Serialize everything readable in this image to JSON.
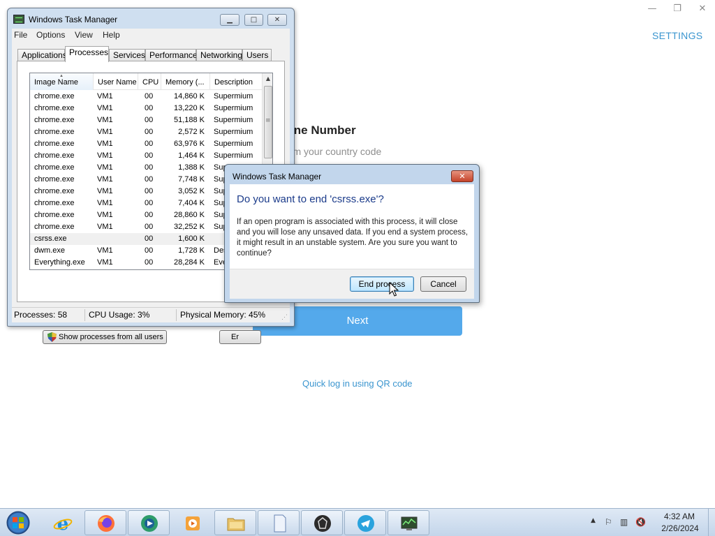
{
  "telegram": {
    "settings_label": "SETTINGS",
    "title_partial": "hone Number",
    "subtitle_partial": "nfirm your country code",
    "next_label": "Next",
    "qr_link": "Quick log in using QR code",
    "minimize_glyph": "—",
    "restore_glyph": "❐",
    "close_glyph": "✕"
  },
  "task_manager": {
    "title": "Windows Task Manager",
    "menu": [
      "File",
      "Options",
      "View",
      "Help"
    ],
    "tabs": [
      "Applications",
      "Processes",
      "Services",
      "Performance",
      "Networking",
      "Users"
    ],
    "active_tab": "Processes",
    "columns": [
      "Image Name",
      "User Name",
      "CPU",
      "Memory (...",
      "Description"
    ],
    "rows": [
      {
        "name": "chrome.exe",
        "user": "VM1",
        "cpu": "00",
        "mem": "14,860 K",
        "desc": "Supermium"
      },
      {
        "name": "chrome.exe",
        "user": "VM1",
        "cpu": "00",
        "mem": "13,220 K",
        "desc": "Supermium"
      },
      {
        "name": "chrome.exe",
        "user": "VM1",
        "cpu": "00",
        "mem": "51,188 K",
        "desc": "Supermium"
      },
      {
        "name": "chrome.exe",
        "user": "VM1",
        "cpu": "00",
        "mem": "2,572 K",
        "desc": "Supermium"
      },
      {
        "name": "chrome.exe",
        "user": "VM1",
        "cpu": "00",
        "mem": "63,976 K",
        "desc": "Supermium"
      },
      {
        "name": "chrome.exe",
        "user": "VM1",
        "cpu": "00",
        "mem": "1,464 K",
        "desc": "Supermium"
      },
      {
        "name": "chrome.exe",
        "user": "VM1",
        "cpu": "00",
        "mem": "1,388 K",
        "desc": "Sup"
      },
      {
        "name": "chrome.exe",
        "user": "VM1",
        "cpu": "00",
        "mem": "7,748 K",
        "desc": "Sup"
      },
      {
        "name": "chrome.exe",
        "user": "VM1",
        "cpu": "00",
        "mem": "3,052 K",
        "desc": "Sup"
      },
      {
        "name": "chrome.exe",
        "user": "VM1",
        "cpu": "00",
        "mem": "7,404 K",
        "desc": "Sup"
      },
      {
        "name": "chrome.exe",
        "user": "VM1",
        "cpu": "00",
        "mem": "28,860 K",
        "desc": "Sup"
      },
      {
        "name": "chrome.exe",
        "user": "VM1",
        "cpu": "00",
        "mem": "32,252 K",
        "desc": "Sup"
      },
      {
        "name": "csrss.exe",
        "user": "",
        "cpu": "00",
        "mem": "1,600 K",
        "desc": "",
        "selected": true
      },
      {
        "name": "dwm.exe",
        "user": "VM1",
        "cpu": "00",
        "mem": "1,728 K",
        "desc": "Des"
      },
      {
        "name": "Everything.exe",
        "user": "VM1",
        "cpu": "00",
        "mem": "28,284 K",
        "desc": "Eve"
      }
    ],
    "show_all_label": "Show processes from all users",
    "end_process_partial": "Er",
    "status": {
      "processes": "Processes: 58",
      "cpu": "CPU Usage: 3%",
      "memory": "Physical Memory: 45%"
    }
  },
  "dialog": {
    "title": "Windows Task Manager",
    "close_glyph": "✕",
    "heading": "Do you want to end 'csrss.exe'?",
    "message": "If an open program is associated with this process, it will close and you will lose any unsaved data. If you end a system process, it might result in an unstable system. Are you sure you want to continue?",
    "confirm_label": "End process",
    "cancel_label": "Cancel"
  },
  "taskbar": {
    "items": [
      "start-orb",
      "internet-explorer",
      "firefox",
      "media-center",
      "media-player",
      "file-explorer",
      "notepad",
      "obsidian",
      "telegram",
      "task-manager"
    ],
    "tray_icons": [
      "show-hidden-icons",
      "action-center-flag",
      "network",
      "volume-muted"
    ],
    "time": "4:32 AM",
    "date": "2/26/2024"
  },
  "colors": {
    "telegram_accent": "#54a9eb",
    "link_blue": "#3a95cf",
    "dialog_heading": "#1b3b8a",
    "window_frame": "#cfdff0"
  }
}
